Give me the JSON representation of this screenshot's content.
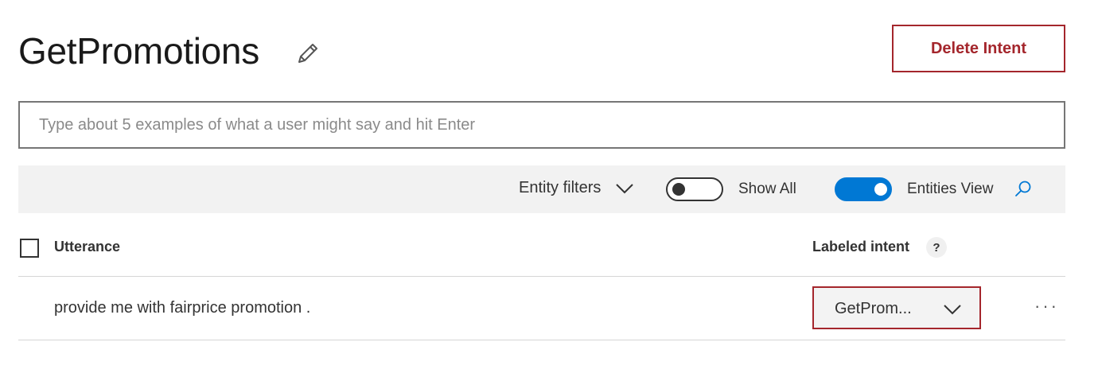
{
  "header": {
    "title": "GetPromotions",
    "delete_label": "Delete Intent"
  },
  "utterance_input": {
    "placeholder": "Type about 5 examples of what a user might say and hit Enter",
    "value": ""
  },
  "filter_bar": {
    "entity_filters_label": "Entity filters",
    "show_all_label": "Show All",
    "show_all_on": false,
    "entities_view_label": "Entities View",
    "entities_view_on": true
  },
  "table": {
    "columns": {
      "utterance": "Utterance",
      "labeled_intent": "Labeled intent",
      "help": "?"
    },
    "rows": [
      {
        "utterance": "provide me with fairprice promotion .",
        "intent": "GetProm..."
      }
    ],
    "more_label": "···"
  },
  "colors": {
    "accent_red": "#a4262c",
    "toggle_blue": "#0078d4",
    "filter_bar_bg": "#f2f2f2"
  }
}
